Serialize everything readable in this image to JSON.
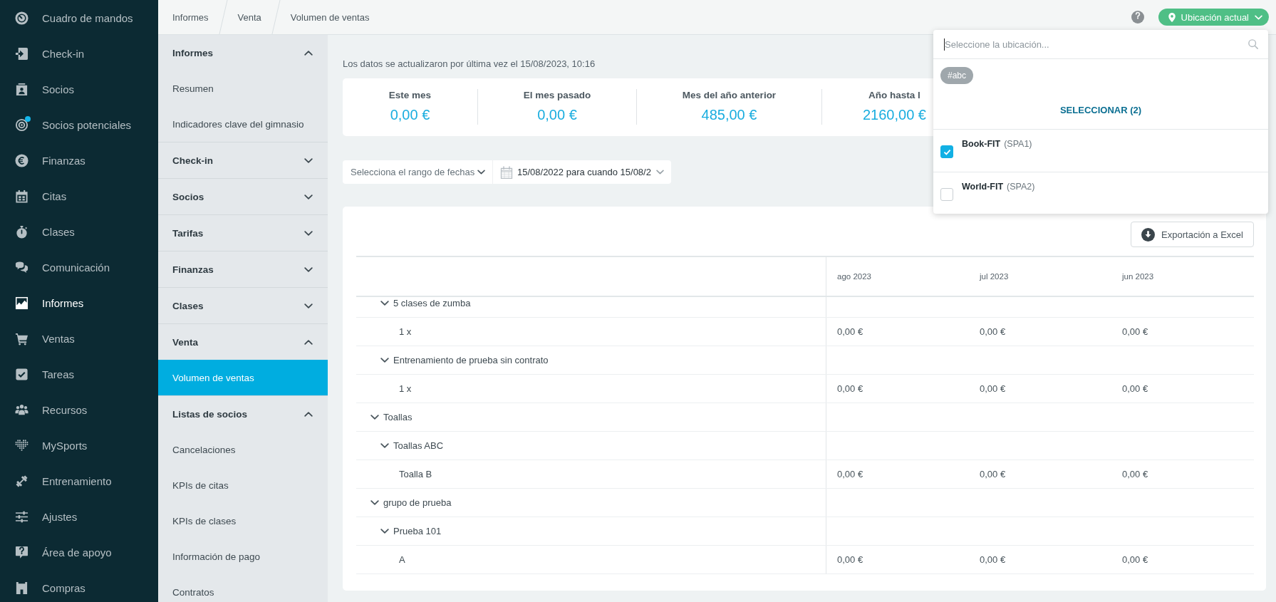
{
  "nav": [
    {
      "label": "Cuadro de mandos",
      "selected": false,
      "notification": false
    },
    {
      "label": "Check-in",
      "selected": false,
      "notification": false
    },
    {
      "label": "Socios",
      "selected": false,
      "notification": false
    },
    {
      "label": "Socios potenciales",
      "selected": false,
      "notification": true
    },
    {
      "label": "Finanzas",
      "selected": false,
      "notification": false
    },
    {
      "label": "Citas",
      "selected": false,
      "notification": false
    },
    {
      "label": "Clases",
      "selected": false,
      "notification": false
    },
    {
      "label": "Comunicación",
      "selected": false,
      "notification": false
    },
    {
      "label": "Informes",
      "selected": true,
      "notification": false
    },
    {
      "label": "Ventas",
      "selected": false,
      "notification": false
    },
    {
      "label": "Tareas",
      "selected": false,
      "notification": false
    },
    {
      "label": "Recursos",
      "selected": false,
      "notification": false
    },
    {
      "label": "MySports",
      "selected": false,
      "notification": false
    },
    {
      "label": "Entrenamiento",
      "selected": false,
      "notification": false
    },
    {
      "label": "Ajustes",
      "selected": false,
      "notification": false
    },
    {
      "label": "Área de apoyo",
      "selected": false,
      "notification": false
    },
    {
      "label": "Compras",
      "selected": false,
      "notification": false
    }
  ],
  "breadcrumb": [
    "Informes",
    "Venta",
    "Volumen de ventas"
  ],
  "location_button": {
    "label": "Ubicación actual"
  },
  "report_menu": [
    {
      "label": "Informes",
      "expanded": true,
      "items": [
        {
          "label": "Resumen",
          "selected": false
        },
        {
          "label": "Indicadores clave del gimnasio",
          "selected": false
        }
      ]
    },
    {
      "label": "Check-in",
      "expanded": false
    },
    {
      "label": "Socios",
      "expanded": false
    },
    {
      "label": "Tarifas",
      "expanded": false
    },
    {
      "label": "Finanzas",
      "expanded": false
    },
    {
      "label": "Clases",
      "expanded": false
    },
    {
      "label": "Venta",
      "expanded": true,
      "items": [
        {
          "label": "Volumen de ventas",
          "selected": true
        }
      ]
    },
    {
      "label": "Listas de socios",
      "expanded": true,
      "items": [
        {
          "label": "Cancelaciones",
          "selected": false
        },
        {
          "label": "KPIs de citas",
          "selected": false
        },
        {
          "label": "KPIs de clases",
          "selected": false
        },
        {
          "label": "Información de pago",
          "selected": false
        },
        {
          "label": "Contratos",
          "selected": false
        }
      ]
    }
  ],
  "last_updated": "Los datos se actualizaron por última vez el 15/08/2023, 10:16",
  "stats": [
    {
      "label": "Este mes",
      "value": "0,00 €"
    },
    {
      "label": "El mes pasado",
      "value": "0,00 €"
    },
    {
      "label": "Mes del año anterior",
      "value": "485,00 €"
    },
    {
      "label": "Año hasta l",
      "value": "2160,00 €"
    }
  ],
  "filters": {
    "range_select": {
      "placeholder": "Selecciona el rango de fechas"
    },
    "date_range": {
      "value": "15/08/2022 para cuando 15/08/2"
    }
  },
  "export_button": {
    "label": "Exportación a Excel"
  },
  "sales_table": {
    "columns": [
      "ago 2023",
      "jul 2023",
      "jun 2023"
    ],
    "rows": [
      {
        "children": [
          {
            "label": "5 clases de zumba",
            "expanded": true,
            "children": [
              {
                "label": "1 x",
                "values": [
                  "0,00 €",
                  "0,00 €",
                  "0,00 €"
                ]
              }
            ]
          },
          {
            "label": "Entrenamiento de prueba sin contrato",
            "expanded": true,
            "children": [
              {
                "label": "1 x",
                "values": [
                  "0,00 €",
                  "0,00 €",
                  "0,00 €"
                ]
              }
            ]
          }
        ]
      },
      {
        "label": "Toallas",
        "expanded": true,
        "children": [
          {
            "label": "Toallas ABC",
            "expanded": true,
            "children": [
              {
                "label": "Toalla B",
                "values": [
                  "0,00 €",
                  "0,00 €",
                  "0,00 €"
                ]
              }
            ]
          }
        ]
      },
      {
        "label": "grupo de prueba",
        "expanded": true,
        "children": [
          {
            "label": "Prueba 101",
            "expanded": true,
            "children": [
              {
                "label": "A",
                "values": [
                  "0,00 €",
                  "0,00 €",
                  "0,00 €"
                ]
              }
            ]
          }
        ]
      }
    ]
  },
  "location_menu": {
    "search": {
      "placeholder": "Seleccione la ubicación...",
      "focused": true
    },
    "tags": [
      "#abc"
    ],
    "select_all": "SELECCIONAR (2)",
    "options": [
      {
        "name": "Book-FIT",
        "code": "(SPA1)",
        "checked": true
      },
      {
        "name": "World-FIT",
        "code": "(SPA2)",
        "checked": false
      }
    ]
  }
}
